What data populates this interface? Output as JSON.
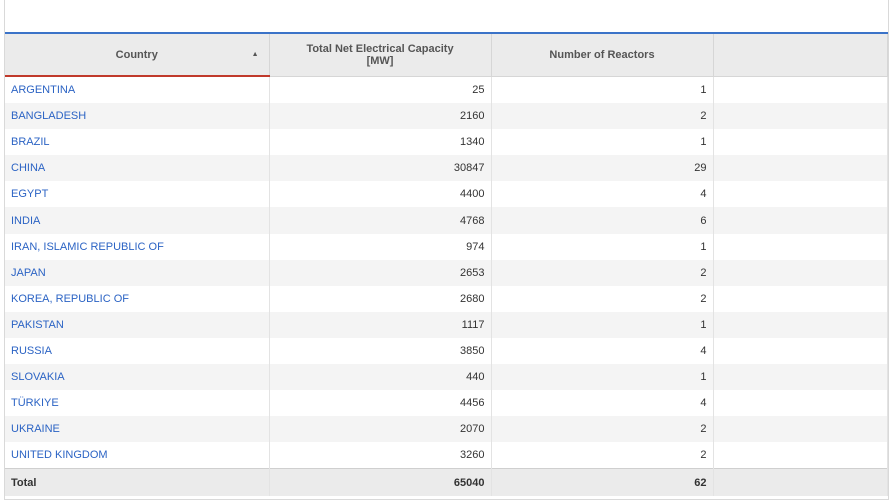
{
  "table": {
    "headers": {
      "country": "Country",
      "capacity": "Total Net Electrical Capacity\n[MW]",
      "reactors": "Number of Reactors",
      "extra": ""
    },
    "sort_indicator": "▲",
    "rows": [
      {
        "country": "ARGENTINA",
        "capacity": "25",
        "reactors": "1"
      },
      {
        "country": "BANGLADESH",
        "capacity": "2160",
        "reactors": "2"
      },
      {
        "country": "BRAZIL",
        "capacity": "1340",
        "reactors": "1"
      },
      {
        "country": "CHINA",
        "capacity": "30847",
        "reactors": "29"
      },
      {
        "country": "EGYPT",
        "capacity": "4400",
        "reactors": "4"
      },
      {
        "country": "INDIA",
        "capacity": "4768",
        "reactors": "6"
      },
      {
        "country": "IRAN, ISLAMIC REPUBLIC OF",
        "capacity": "974",
        "reactors": "1"
      },
      {
        "country": "JAPAN",
        "capacity": "2653",
        "reactors": "2"
      },
      {
        "country": "KOREA, REPUBLIC OF",
        "capacity": "2680",
        "reactors": "2"
      },
      {
        "country": "PAKISTAN",
        "capacity": "1117",
        "reactors": "1"
      },
      {
        "country": "RUSSIA",
        "capacity": "3850",
        "reactors": "4"
      },
      {
        "country": "SLOVAKIA",
        "capacity": "440",
        "reactors": "1"
      },
      {
        "country": "TÜRKIYE",
        "capacity": "4456",
        "reactors": "4"
      },
      {
        "country": "UKRAINE",
        "capacity": "2070",
        "reactors": "2"
      },
      {
        "country": "UNITED KINGDOM",
        "capacity": "3260",
        "reactors": "2"
      }
    ],
    "total": {
      "label": "Total",
      "capacity": "65040",
      "reactors": "62"
    }
  },
  "colors": {
    "link": "#2b63c4",
    "accent_bar": "#3b73c8",
    "sort_underline": "#c0392b"
  }
}
